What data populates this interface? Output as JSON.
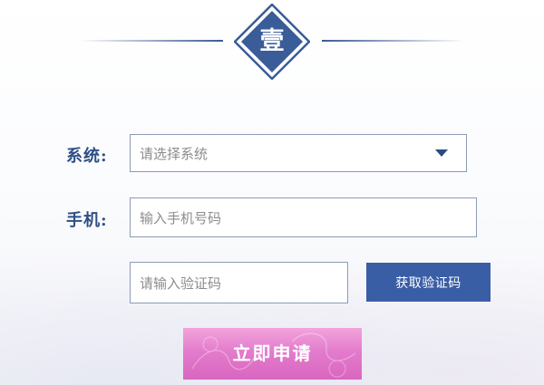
{
  "header": {
    "step_badge": "壹"
  },
  "form": {
    "system": {
      "label": "系统:",
      "placeholder": "请选择系统"
    },
    "phone": {
      "label": "手机:",
      "placeholder": "输入手机号码"
    },
    "code": {
      "placeholder": "请输入验证码"
    },
    "get_code_button": "获取验证码",
    "submit_button": "立即申请"
  },
  "colors": {
    "brand_blue": "#3a5ea6",
    "label_blue": "#2f4f86",
    "submit_pink": "#e37ccc"
  },
  "icons": {
    "dropdown": "chevron-down-icon"
  }
}
